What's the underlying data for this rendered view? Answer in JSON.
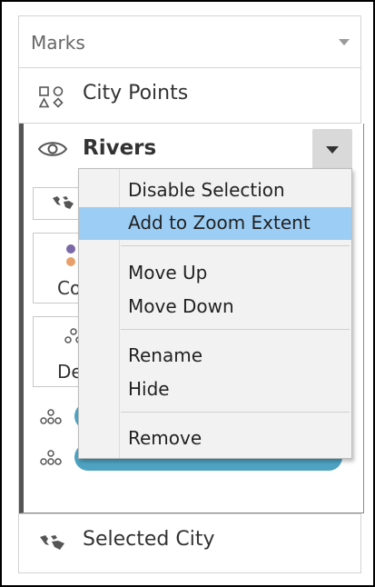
{
  "marks": {
    "title": "Marks"
  },
  "layers": {
    "city_points": {
      "label": "City Points"
    },
    "rivers": {
      "label": "Rivers",
      "cards": {
        "color_label": "Co",
        "detail_label": "De"
      }
    },
    "selected_city": {
      "label": "Selected City"
    }
  },
  "context_menu": {
    "items": [
      {
        "label": "Disable Selection",
        "highlighted": false
      },
      {
        "label": "Add to Zoom Extent",
        "highlighted": true
      },
      {
        "label": "Move Up",
        "highlighted": false
      },
      {
        "label": "Move Down",
        "highlighted": false
      },
      {
        "label": "Rename",
        "highlighted": false
      },
      {
        "label": "Hide",
        "highlighted": false
      },
      {
        "label": "Remove",
        "highlighted": false
      }
    ]
  },
  "colors": {
    "highlight": "#9ccdf5",
    "pill": "#4ea3c2",
    "color_dot_purple": "#7b68a6",
    "color_dot_orange": "#e8a06a"
  },
  "icons": {
    "city_points": "shapes-icon",
    "rivers": "eye-icon",
    "selected_city": "map-icon",
    "detail": "detail-dots-icon"
  }
}
